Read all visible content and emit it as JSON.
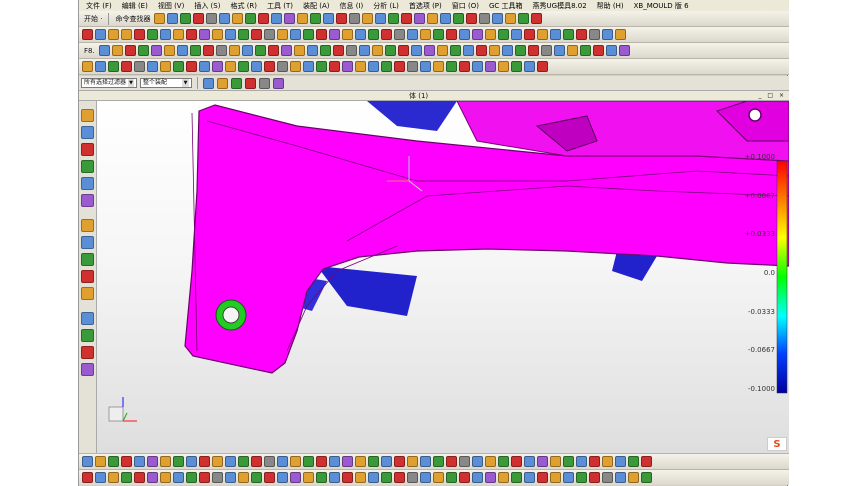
{
  "menu": [
    "文件 (F)",
    "编辑 (E)",
    "视图 (V)",
    "插入 (S)",
    "格式 (R)",
    "工具 (T)",
    "装配 (A)",
    "信息 (I)",
    "分析 (L)",
    "首选项 (P)",
    "窗口 (O)",
    "GC 工具箱",
    "燕秀UG模具8.02",
    "帮助 (H)",
    "XB_MOULD 版 6"
  ],
  "toolbar": {
    "start_label": "开始 ·",
    "command_finder_label": "命令查找器",
    "rows": [
      [
        "#e0a030",
        "#5a8fd8",
        "#3a9a3a",
        "#d03030",
        "#888888",
        "#5a8fd8",
        "#e0a030",
        "#3a9a3a",
        "#d03030",
        "#5a8fd8",
        "#9a5ad0",
        "#e0a030",
        "#3a9a3a",
        "#5a8fd8",
        "#d03030",
        "#888888",
        "#e0a030",
        "#5a8fd8",
        "#3a9a3a",
        "#d03030",
        "#9a5ad0",
        "#e0a030",
        "#5a8fd8",
        "#3a9a3a",
        "#d03030",
        "#888888",
        "#5a8fd8",
        "#e0a030",
        "#3a9a3a",
        "#d03030",
        "#5a8fd8",
        "#9a5ad0",
        "#e0a030",
        "#3a9a3a",
        "#5a8fd8",
        "#d03030"
      ],
      [
        "#d03030",
        "#5a8fd8",
        "#e0a030",
        "#e0a030",
        "#d03030",
        "#3a9a3a",
        "#5a8fd8",
        "#e0a030",
        "#d03030",
        "#9a5ad0",
        "#e0a030",
        "#5a8fd8",
        "#3a9a3a",
        "#d03030",
        "#888888",
        "#e0a030",
        "#5a8fd8",
        "#3a9a3a",
        "#d03030",
        "#9a5ad0",
        "#e0a030",
        "#5a8fd8",
        "#3a9a3a",
        "#d03030",
        "#888888",
        "#5a8fd8",
        "#e0a030",
        "#3a9a3a",
        "#d03030",
        "#5a8fd8",
        "#9a5ad0",
        "#e0a030",
        "#3a9a3a",
        "#5a8fd8",
        "#d03030",
        "#e0a030",
        "#5a8fd8",
        "#3a9a3a",
        "#d03030",
        "#888888",
        "#5a8fd8",
        "#e0a030"
      ],
      [
        "#5a8fd8",
        "#e0a030",
        "#d03030",
        "#3a9a3a",
        "#9a5ad0",
        "#e0a030",
        "#5a8fd8",
        "#3a9a3a",
        "#d03030",
        "#888888",
        "#e0a030",
        "#5a8fd8",
        "#3a9a3a",
        "#d03030",
        "#9a5ad0",
        "#e0a030",
        "#5a8fd8",
        "#3a9a3a",
        "#d03030",
        "#888888",
        "#5a8fd8",
        "#e0a030",
        "#3a9a3a",
        "#d03030",
        "#5a8fd8",
        "#9a5ad0",
        "#e0a030",
        "#3a9a3a",
        "#5a8fd8",
        "#d03030",
        "#e0a030",
        "#5a8fd8",
        "#3a9a3a",
        "#d03030",
        "#888888",
        "#5a8fd8",
        "#e0a030",
        "#3a9a3a",
        "#d03030",
        "#5a8fd8",
        "#9a5ad0"
      ]
    ],
    "row3_f8_label": "F8."
  },
  "filterbar": {
    "type_filter": "所有选择过滤器",
    "scope_filter": "整个装配"
  },
  "viewport_title": "体 (1)",
  "window_controls": "_ □ ×",
  "left_toolbar_colors": [
    "#e0a030",
    "#5a8fd8",
    "#d03030",
    "#3a9a3a",
    "#5a8fd8",
    "#9a5ad0",
    "#e0a030",
    "#5a8fd8",
    "#3a9a3a",
    "#d03030",
    "#e0a030",
    "#5a8fd8",
    "#3a9a3a",
    "#d03030",
    "#9a5ad0"
  ],
  "legend": {
    "labels": [
      "+0.1000",
      "+0.0667",
      "+0.0333",
      "0.0",
      "-0.0333",
      "-0.0667",
      "-0.1000"
    ],
    "colors": [
      "#ff0000",
      "#ff8000",
      "#ffff00",
      "#00ff00",
      "#00ffff",
      "#0040ff",
      "#0000a0"
    ]
  },
  "model": {
    "main_color": "#ff00ff",
    "shadow_color": "#2222cc",
    "hole_ring_color": "#22cc22",
    "bg_top": "#ffffff",
    "bg_bottom": "#dedede"
  },
  "bottom_toolbar": {
    "rows": [
      [
        "#5a8fd8",
        "#e0a030",
        "#3a9a3a",
        "#d03030",
        "#5a8fd8",
        "#9a5ad0",
        "#e0a030",
        "#3a9a3a",
        "#5a8fd8",
        "#d03030",
        "#e0a030",
        "#5a8fd8",
        "#3a9a3a",
        "#d03030",
        "#888888",
        "#5a8fd8",
        "#e0a030",
        "#3a9a3a",
        "#d03030",
        "#5a8fd8",
        "#9a5ad0",
        "#e0a030",
        "#3a9a3a",
        "#5a8fd8",
        "#d03030",
        "#e0a030",
        "#5a8fd8",
        "#3a9a3a",
        "#d03030",
        "#888888",
        "#5a8fd8",
        "#e0a030",
        "#3a9a3a",
        "#d03030",
        "#5a8fd8",
        "#9a5ad0",
        "#e0a030",
        "#3a9a3a",
        "#5a8fd8",
        "#d03030",
        "#e0a030",
        "#5a8fd8",
        "#3a9a3a",
        "#d03030"
      ],
      [
        "#d03030",
        "#5a8fd8",
        "#e0a030",
        "#3a9a3a",
        "#d03030",
        "#9a5ad0",
        "#e0a030",
        "#5a8fd8",
        "#3a9a3a",
        "#d03030",
        "#888888",
        "#5a8fd8",
        "#e0a030",
        "#3a9a3a",
        "#d03030",
        "#5a8fd8",
        "#9a5ad0",
        "#e0a030",
        "#3a9a3a",
        "#5a8fd8",
        "#d03030",
        "#e0a030",
        "#5a8fd8",
        "#3a9a3a",
        "#d03030",
        "#888888",
        "#5a8fd8",
        "#e0a030",
        "#3a9a3a",
        "#d03030",
        "#5a8fd8",
        "#9a5ad0",
        "#e0a030",
        "#3a9a3a",
        "#5a8fd8",
        "#d03030",
        "#e0a030",
        "#5a8fd8",
        "#3a9a3a",
        "#d03030",
        "#888888",
        "#5a8fd8",
        "#e0a030",
        "#3a9a3a"
      ]
    ]
  },
  "watermark_letter": "S"
}
